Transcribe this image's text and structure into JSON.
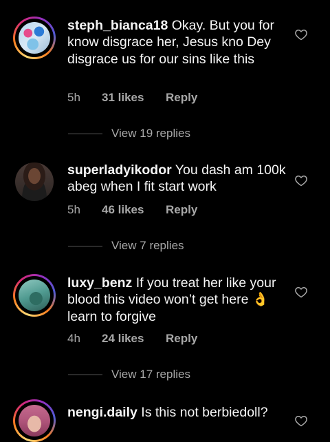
{
  "comments": [
    {
      "username": "steph_bianca18",
      "text": "Okay. But you for know disgrace her, Jesus kno Dey disgrace us for our sins like this",
      "time": "5h",
      "likes": "31 likes",
      "reply": "Reply",
      "view_replies": "View 19 replies",
      "has_story_ring": true
    },
    {
      "username": "superladyikodor",
      "text": "You dash am 100k abeg when I fit start work",
      "time": "5h",
      "likes": "46 likes",
      "reply": "Reply",
      "view_replies": "View 7 replies",
      "has_story_ring": false
    },
    {
      "username": "luxy_benz",
      "text": "If you treat her like your blood this video won’t get here 👌 learn to forgive",
      "time": "4h",
      "likes": "24 likes",
      "reply": "Reply",
      "view_replies": "View 17 replies",
      "has_story_ring": true
    },
    {
      "username": "nengi.daily",
      "text": "Is this not berbiedoll?",
      "has_story_ring": true
    }
  ],
  "icons": {
    "like": "heart-outline-icon"
  },
  "colors": {
    "background": "#000000",
    "primary_text": "#f5f5f5",
    "secondary_text": "#a8a8a8"
  }
}
